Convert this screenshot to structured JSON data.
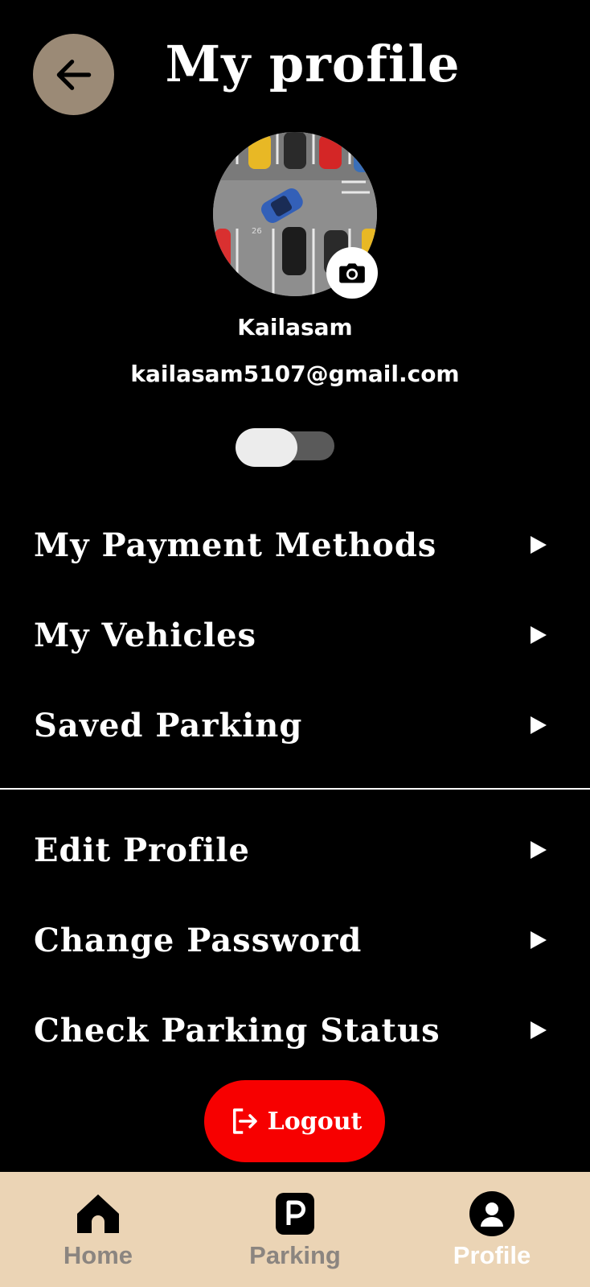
{
  "header": {
    "title": "My profile",
    "back_icon": "arrow-left-icon"
  },
  "profile": {
    "name": "Kailasam",
    "email": "kailasam5107@gmail.com",
    "avatar": "parking-lot-photo",
    "camera_icon": "camera-icon",
    "toggle_on": false
  },
  "menu_primary": [
    {
      "label": "My Payment Methods"
    },
    {
      "label": "My Vehicles"
    },
    {
      "label": "Saved Parking"
    }
  ],
  "menu_secondary": [
    {
      "label": "Edit Profile"
    },
    {
      "label": "Change Password"
    },
    {
      "label": "Check Parking Status"
    }
  ],
  "logout": {
    "label": "Logout",
    "icon": "logout-icon"
  },
  "bottom_nav": {
    "items": [
      {
        "label": "Home",
        "icon": "home-icon",
        "active": false
      },
      {
        "label": "Parking",
        "icon": "parking-icon",
        "active": false
      },
      {
        "label": "Profile",
        "icon": "user-icon",
        "active": true
      }
    ]
  },
  "colors": {
    "background": "#000000",
    "back_button": "#9b8a76",
    "logout": "#f70000",
    "nav_bg": "#ebd4b5",
    "nav_inactive": "#8b8580",
    "nav_active": "#ffffff"
  }
}
